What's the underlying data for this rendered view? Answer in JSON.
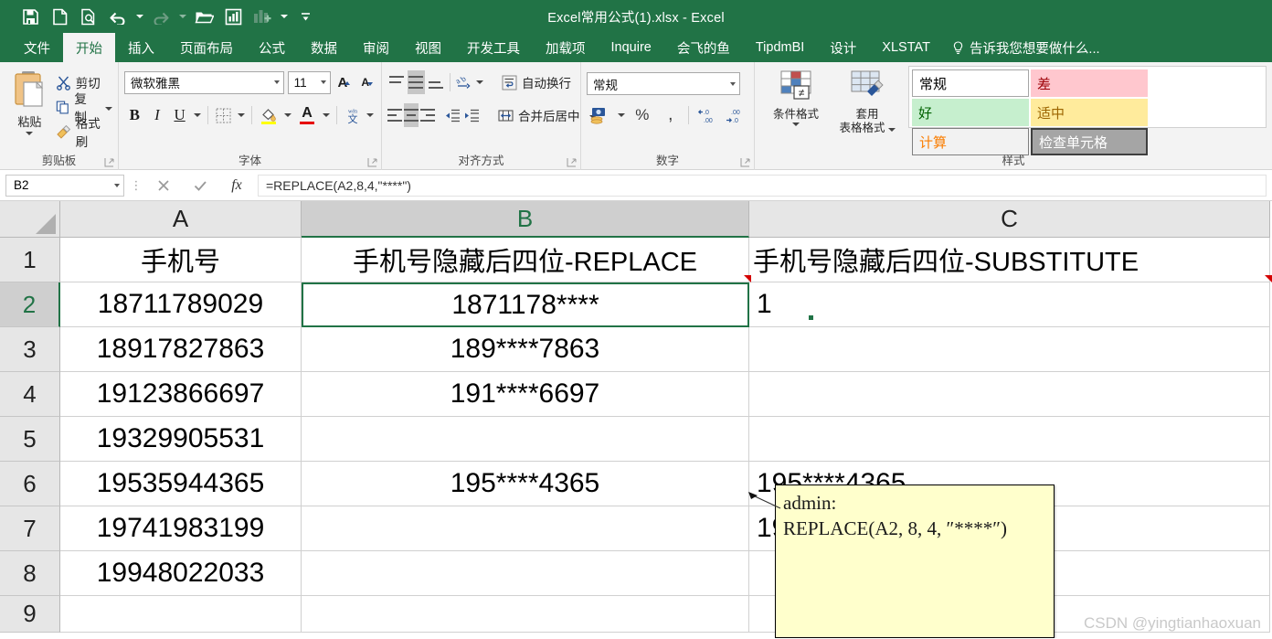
{
  "titlebar": {
    "document_title": "Excel常用公式(1).xlsx - Excel",
    "quick_access": [
      {
        "name": "save-icon",
        "label": "保存"
      },
      {
        "name": "new-file-icon",
        "label": "新建"
      },
      {
        "name": "print-preview-icon",
        "label": "打印预览"
      },
      {
        "name": "undo-icon",
        "label": "撤消"
      },
      {
        "name": "redo-icon",
        "label": "恢复"
      },
      {
        "name": "open-folder-icon",
        "label": "打开"
      },
      {
        "name": "chart-sheet-icon",
        "label": "图表"
      },
      {
        "name": "add-chart-icon",
        "label": "添加图表"
      },
      {
        "name": "customize-qat-icon",
        "label": "自定义快速访问工具栏"
      }
    ]
  },
  "tabs": [
    {
      "label": "文件",
      "active": false
    },
    {
      "label": "开始",
      "active": true
    },
    {
      "label": "插入",
      "active": false
    },
    {
      "label": "页面布局",
      "active": false
    },
    {
      "label": "公式",
      "active": false
    },
    {
      "label": "数据",
      "active": false
    },
    {
      "label": "审阅",
      "active": false
    },
    {
      "label": "视图",
      "active": false
    },
    {
      "label": "开发工具",
      "active": false
    },
    {
      "label": "加载项",
      "active": false
    },
    {
      "label": "Inquire",
      "active": false
    },
    {
      "label": "会飞的鱼",
      "active": false
    },
    {
      "label": "TipdmBI",
      "active": false
    },
    {
      "label": "设计",
      "active": false
    },
    {
      "label": "XLSTAT",
      "active": false
    }
  ],
  "tell_me": {
    "label": "告诉我您想要做什么...",
    "icon": "lightbulb-icon"
  },
  "ribbon": {
    "clipboard": {
      "group_label": "剪贴板",
      "paste_label": "粘贴",
      "cut_label": "剪切",
      "copy_label": "复制",
      "format_painter_label": "格式刷"
    },
    "font": {
      "group_label": "字体",
      "font_name": "微软雅黑",
      "font_size": "11",
      "grow_font_label": "增大字号",
      "shrink_font_label": "减小字号",
      "bold_label": "B",
      "italic_label": "I",
      "underline_label": "U",
      "border_label": "边框",
      "fill_color_label": "填充颜色",
      "font_color_label": "字体颜色",
      "phonetic_label": "拼音指南"
    },
    "alignment": {
      "group_label": "对齐方式",
      "wrap_text_label": "自动换行",
      "merge_center_label": "合并后居中",
      "orientation_label": "方向",
      "decrease_indent_label": "减少缩进量",
      "increase_indent_label": "增加缩进量"
    },
    "number": {
      "group_label": "数字",
      "format_value": "常规",
      "accounting_label": "会计数字格式",
      "percent_label": "%",
      "comma_label": ",",
      "increase_decimal_label": "增加小数位数",
      "decrease_decimal_label": "减少小数位数"
    },
    "styles": {
      "group_label": "样式",
      "conditional_format_label": "条件格式",
      "format_as_table_line1": "套用",
      "format_as_table_line2": "表格格式",
      "cell_styles": [
        {
          "label": "常规",
          "bg": "#ffffff",
          "fg": "#000000",
          "border": "#a6a6a6"
        },
        {
          "label": "差",
          "bg": "#ffc7ce",
          "fg": "#9c0006",
          "border": "#ffc7ce"
        },
        {
          "label": "好",
          "bg": "#c6efce",
          "fg": "#006100",
          "border": "#c6efce"
        },
        {
          "label": "适中",
          "bg": "#ffeb9c",
          "fg": "#9c6500",
          "border": "#ffeb9c"
        },
        {
          "label": "计算",
          "bg": "#f2f2f2",
          "fg": "#fa7d00",
          "border": "#7f7f7f"
        },
        {
          "label": "检查单元格",
          "bg": "#a5a5a5",
          "fg": "#ffffff",
          "border": "#3f3f3f"
        }
      ]
    }
  },
  "formula_bar": {
    "name_box": "B2",
    "cancel_label": "取消",
    "enter_label": "输入",
    "fx_label": "fx",
    "formula": "=REPLACE(A2,8,4,\"****\")"
  },
  "sheet": {
    "columns": [
      {
        "id": "A",
        "selected": false
      },
      {
        "id": "B",
        "selected": true
      },
      {
        "id": "C",
        "selected": false
      }
    ],
    "rows": [
      {
        "n": "1",
        "selected": false,
        "a": "手机号",
        "b": "手机号隐藏后四位-REPLACE",
        "c": "手机号隐藏后四位-SUBSTITUTE"
      },
      {
        "n": "2",
        "selected": true,
        "a": "18711789029",
        "b": "1871178****",
        "c": "1"
      },
      {
        "n": "3",
        "selected": false,
        "a": "18917827863",
        "b": "189****7863",
        "c": ""
      },
      {
        "n": "4",
        "selected": false,
        "a": "19123866697",
        "b": "191****6697",
        "c": ""
      },
      {
        "n": "5",
        "selected": false,
        "a": "19329905531",
        "b": "",
        "c": ""
      },
      {
        "n": "6",
        "selected": false,
        "a": "19535944365",
        "b": "195****4365",
        "c": "195****4365"
      },
      {
        "n": "7",
        "selected": false,
        "a": "19741983199",
        "b": "",
        "c": "1974198####"
      },
      {
        "n": "8",
        "selected": false,
        "a": "19948022033",
        "b": "",
        "c": ""
      },
      {
        "n": "9",
        "selected": false,
        "a": "",
        "b": "",
        "c": ""
      }
    ],
    "active_cell": "B2"
  },
  "comment": {
    "author": "admin:",
    "body": "REPLACE(A2, 8, 4, ″****″)"
  },
  "watermark": "CSDN @yingtianhaoxuan"
}
